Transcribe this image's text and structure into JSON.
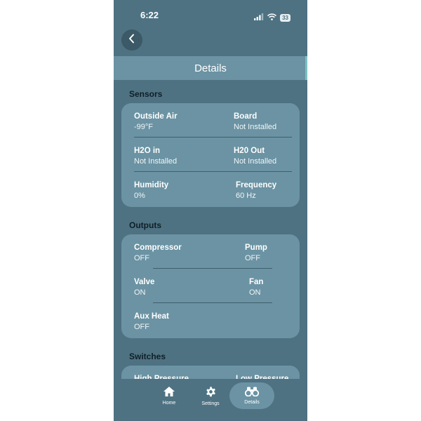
{
  "status": {
    "time": "6:22",
    "battery": "33"
  },
  "header": {
    "title": "Details"
  },
  "sensors": {
    "title": "Sensors",
    "rows": [
      [
        {
          "label": "Outside Air",
          "value": "-99°F"
        },
        {
          "label": "Board",
          "value": "Not Installed"
        }
      ],
      [
        {
          "label": "H2O in",
          "value": "Not Installed"
        },
        {
          "label": "H20 Out",
          "value": "Not Installed"
        }
      ],
      [
        {
          "label": "Humidity",
          "value": "0%"
        },
        {
          "label": "Frequency",
          "value": "60 Hz"
        }
      ]
    ]
  },
  "outputs": {
    "title": "Outputs",
    "rows": [
      [
        {
          "label": "Compressor",
          "value": "OFF"
        },
        {
          "label": "Pump",
          "value": "OFF"
        }
      ],
      [
        {
          "label": "Valve",
          "value": "ON"
        },
        {
          "label": "Fan",
          "value": "ON"
        }
      ],
      [
        {
          "label": "Aux Heat",
          "value": "OFF"
        }
      ]
    ]
  },
  "switches": {
    "title": "Switches",
    "rows": [
      [
        {
          "label": "High Pressure"
        },
        {
          "label": "Low Pressure"
        }
      ]
    ]
  },
  "tabs": [
    {
      "label": "Home",
      "icon": "home-icon",
      "active": false
    },
    {
      "label": "Settings",
      "icon": "gear-icon",
      "active": false
    },
    {
      "label": "Details",
      "icon": "binoculars-icon",
      "active": true
    }
  ]
}
